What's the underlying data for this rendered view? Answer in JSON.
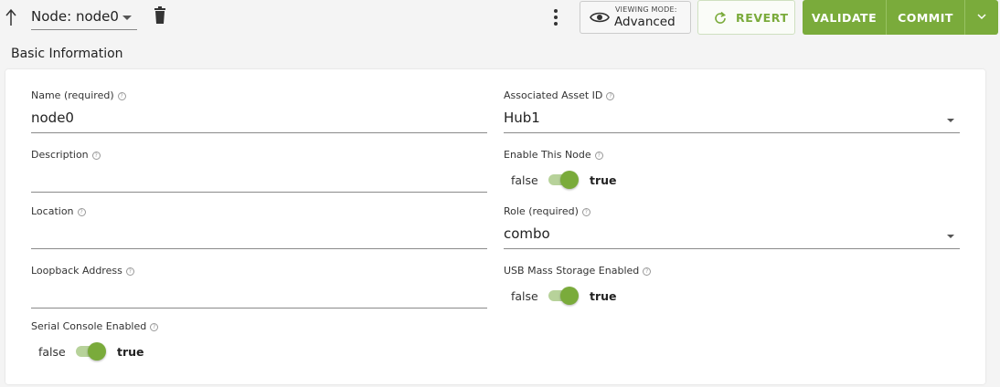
{
  "toolbar": {
    "node_label": "Node: node0",
    "viewing_mode_label": "VIEWING MODE:",
    "viewing_mode_value": "Advanced",
    "revert_label": "REVERT",
    "validate_label": "VALIDATE",
    "commit_label": "COMMIT",
    "accent_color": "#7aab3b"
  },
  "section": {
    "title": "Basic Information"
  },
  "fields": {
    "name": {
      "label": "Name (required)",
      "value": "node0"
    },
    "description": {
      "label": "Description",
      "value": ""
    },
    "location": {
      "label": "Location",
      "value": ""
    },
    "loopback": {
      "label": "Loopback Address",
      "value": ""
    },
    "serial_console": {
      "label": "Serial Console Enabled",
      "false_label": "false",
      "true_label": "true",
      "enabled": true
    },
    "asset_id": {
      "label": "Associated Asset ID",
      "value": "Hub1"
    },
    "enable_node": {
      "label": "Enable This Node",
      "false_label": "false",
      "true_label": "true",
      "enabled": true
    },
    "role": {
      "label": "Role (required)",
      "value": "combo"
    },
    "usb_storage": {
      "label": "USB Mass Storage Enabled",
      "false_label": "false",
      "true_label": "true",
      "enabled": true
    }
  },
  "icons": {
    "help": "?"
  }
}
